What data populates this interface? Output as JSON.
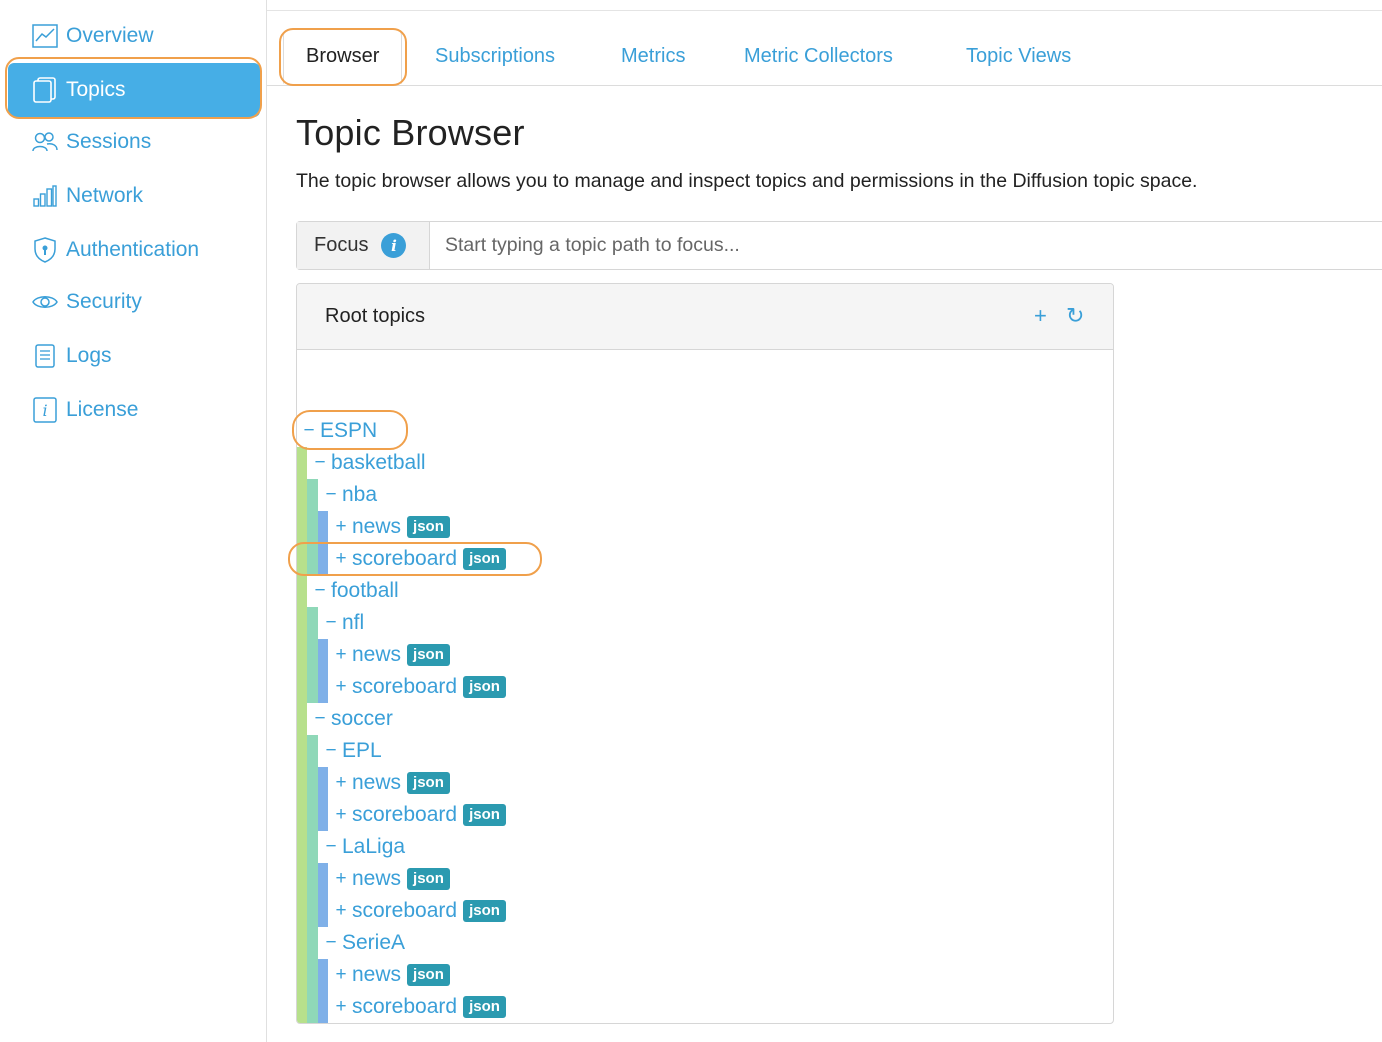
{
  "sidebar": {
    "items": [
      {
        "label": "Overview",
        "icon": "chart-line-icon"
      },
      {
        "label": "Topics",
        "icon": "documents-icon"
      },
      {
        "label": "Sessions",
        "icon": "users-icon"
      },
      {
        "label": "Network",
        "icon": "bar-chart-icon"
      },
      {
        "label": "Authentication",
        "icon": "shield-icon"
      },
      {
        "label": "Security",
        "icon": "eye-icon"
      },
      {
        "label": "Logs",
        "icon": "document-list-icon"
      },
      {
        "label": "License",
        "icon": "info-square-icon"
      }
    ],
    "active": "Topics"
  },
  "tabs": [
    "Browser",
    "Subscriptions",
    "Metrics",
    "Metric Collectors",
    "Topic Views"
  ],
  "active_tab": "Browser",
  "page": {
    "title": "Topic Browser",
    "description": "The topic browser allows you to manage and inspect topics and permissions in the Diffusion topic space."
  },
  "focus": {
    "label": "Focus",
    "placeholder": "Start typing a topic path to focus..."
  },
  "panel": {
    "title": "Root topics",
    "add_symbol": "+",
    "refresh_symbol": "↻"
  },
  "tree": [
    {
      "sign": "−",
      "name": "ESPN",
      "badge": ""
    },
    {
      "sign": "−",
      "name": "basketball",
      "badge": ""
    },
    {
      "sign": "−",
      "name": "nba",
      "badge": ""
    },
    {
      "sign": "+",
      "name": "news",
      "badge": "json"
    },
    {
      "sign": "+",
      "name": "scoreboard",
      "badge": "json"
    },
    {
      "sign": "−",
      "name": "football",
      "badge": ""
    },
    {
      "sign": "−",
      "name": "nfl",
      "badge": ""
    },
    {
      "sign": "+",
      "name": "news",
      "badge": "json"
    },
    {
      "sign": "+",
      "name": "scoreboard",
      "badge": "json"
    },
    {
      "sign": "−",
      "name": "soccer",
      "badge": ""
    },
    {
      "sign": "−",
      "name": "EPL",
      "badge": ""
    },
    {
      "sign": "+",
      "name": "news",
      "badge": "json"
    },
    {
      "sign": "+",
      "name": "scoreboard",
      "badge": "json"
    },
    {
      "sign": "−",
      "name": "LaLiga",
      "badge": ""
    },
    {
      "sign": "+",
      "name": "news",
      "badge": "json"
    },
    {
      "sign": "+",
      "name": "scoreboard",
      "badge": "json"
    },
    {
      "sign": "−",
      "name": "SerieA",
      "badge": ""
    },
    {
      "sign": "+",
      "name": "news",
      "badge": "json"
    },
    {
      "sign": "+",
      "name": "scoreboard",
      "badge": "json"
    }
  ],
  "colors": {
    "accent": "#3a9fd8",
    "active_nav": "#46aee6",
    "highlight": "#f0a04b",
    "badge": "#2b9ab0",
    "level1_bar": "#b7e08c",
    "level2_bar": "#8fd8b8",
    "level3_bar": "#7fb0e8"
  }
}
